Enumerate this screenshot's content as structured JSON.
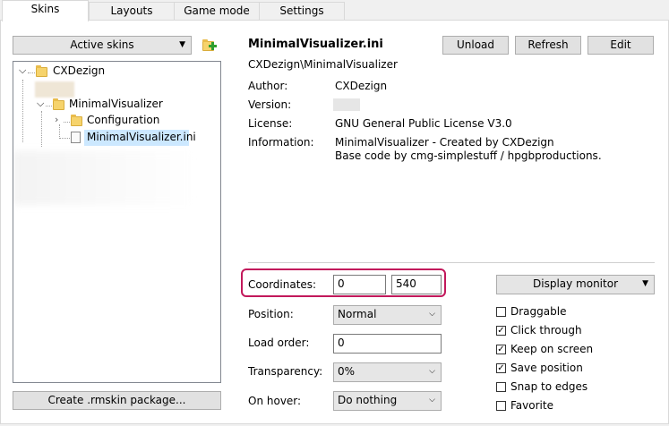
{
  "tabs": [
    {
      "label": "Skins"
    },
    {
      "label": "Layouts"
    },
    {
      "label": "Game mode"
    },
    {
      "label": "Settings"
    }
  ],
  "left": {
    "active_skins_label": "Active skins",
    "create_package_label": "Create .rmskin package..."
  },
  "tree": {
    "root": "CXDezign",
    "child": "MinimalVisualizer",
    "subfolder": "Configuration",
    "file": "MinimalVisualizer.ini"
  },
  "skin": {
    "title": "MinimalVisualizer.ini",
    "path": "CXDezign\\MinimalVisualizer",
    "unload_label": "Unload",
    "refresh_label": "Refresh",
    "edit_label": "Edit",
    "author_label": "Author:",
    "author": "CXDezign",
    "version_label": "Version:",
    "license_label": "License:",
    "license": "GNU General Public License V3.0",
    "information_label": "Information:",
    "information_line1": "MinimalVisualizer - Created by CXDezign",
    "information_line2": "Base code by cmg-simplestuff / hpgbproductions."
  },
  "settings": {
    "coordinates_label": "Coordinates:",
    "coord_x": "0",
    "coord_y": "540",
    "position_label": "Position:",
    "position_value": "Normal",
    "load_order_label": "Load order:",
    "load_order_value": "0",
    "transparency_label": "Transparency:",
    "transparency_value": "0%",
    "on_hover_label": "On hover:",
    "on_hover_value": "Do nothing",
    "display_monitor_label": "Display monitor"
  },
  "checkboxes": [
    {
      "label": "Draggable",
      "checked": false
    },
    {
      "label": "Click through",
      "checked": true
    },
    {
      "label": "Keep on screen",
      "checked": true
    },
    {
      "label": "Save position",
      "checked": true
    },
    {
      "label": "Snap to edges",
      "checked": false
    },
    {
      "label": "Favorite",
      "checked": false
    }
  ],
  "colors": {
    "highlight": "#c2185b",
    "selection": "#cce8ff"
  }
}
